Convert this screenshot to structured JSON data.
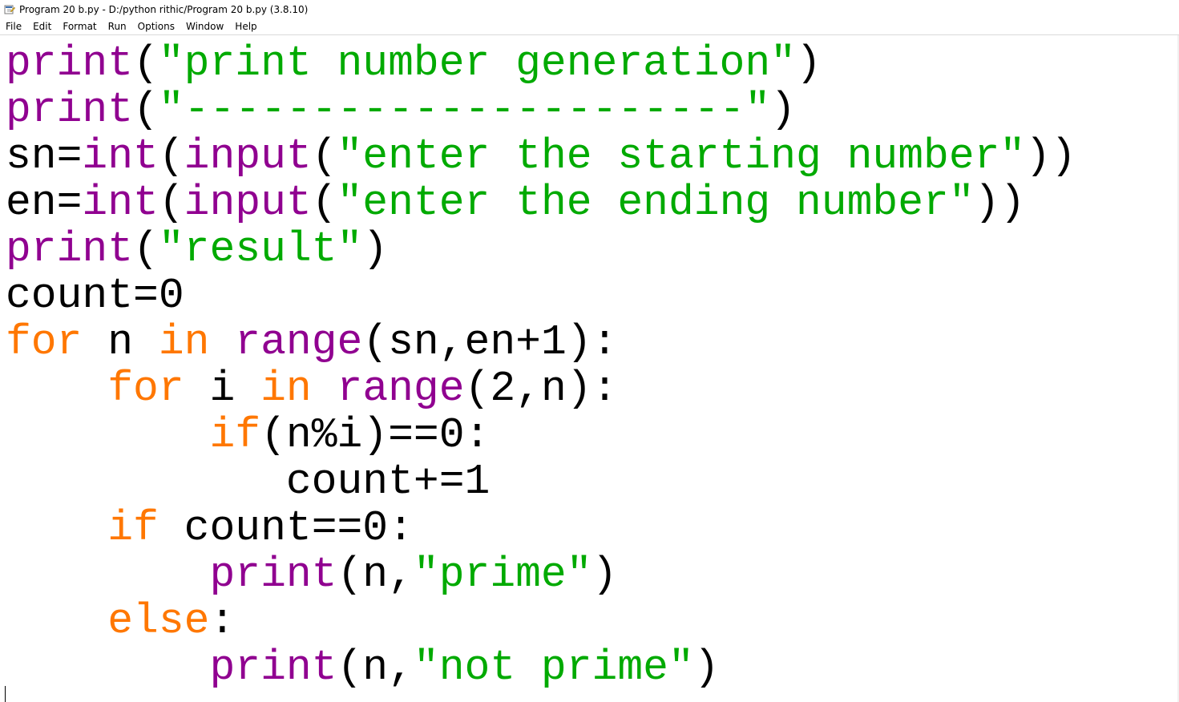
{
  "window": {
    "title": "Program 20 b.py - D:/python rithic/Program 20 b.py (3.8.10)"
  },
  "menu": {
    "items": [
      "File",
      "Edit",
      "Format",
      "Run",
      "Options",
      "Window",
      "Help"
    ]
  },
  "colors": {
    "builtin": "#900090",
    "string": "#00aa00",
    "keyword": "#ff7700",
    "default": "#000000"
  },
  "icons": {
    "app": "python-idle-icon"
  },
  "code": {
    "lines": [
      [
        {
          "t": "print",
          "c": "builtin"
        },
        {
          "t": "(",
          "c": "default"
        },
        {
          "t": "\"print number generation\"",
          "c": "string"
        },
        {
          "t": ")",
          "c": "default"
        }
      ],
      [
        {
          "t": "print",
          "c": "builtin"
        },
        {
          "t": "(",
          "c": "default"
        },
        {
          "t": "\"----------------------\"",
          "c": "string"
        },
        {
          "t": ")",
          "c": "default"
        }
      ],
      [
        {
          "t": "sn=",
          "c": "default"
        },
        {
          "t": "int",
          "c": "builtin"
        },
        {
          "t": "(",
          "c": "default"
        },
        {
          "t": "input",
          "c": "builtin"
        },
        {
          "t": "(",
          "c": "default"
        },
        {
          "t": "\"enter the starting number\"",
          "c": "string"
        },
        {
          "t": "))",
          "c": "default"
        }
      ],
      [
        {
          "t": "en=",
          "c": "default"
        },
        {
          "t": "int",
          "c": "builtin"
        },
        {
          "t": "(",
          "c": "default"
        },
        {
          "t": "input",
          "c": "builtin"
        },
        {
          "t": "(",
          "c": "default"
        },
        {
          "t": "\"enter the ending number\"",
          "c": "string"
        },
        {
          "t": "))",
          "c": "default"
        }
      ],
      [
        {
          "t": "print",
          "c": "builtin"
        },
        {
          "t": "(",
          "c": "default"
        },
        {
          "t": "\"result\"",
          "c": "string"
        },
        {
          "t": ")",
          "c": "default"
        }
      ],
      [
        {
          "t": "count=0",
          "c": "default"
        }
      ],
      [
        {
          "t": "for",
          "c": "keyword"
        },
        {
          "t": " n ",
          "c": "default"
        },
        {
          "t": "in",
          "c": "keyword"
        },
        {
          "t": " ",
          "c": "default"
        },
        {
          "t": "range",
          "c": "builtin"
        },
        {
          "t": "(sn,en+1):",
          "c": "default"
        }
      ],
      [
        {
          "t": "    ",
          "c": "default"
        },
        {
          "t": "for",
          "c": "keyword"
        },
        {
          "t": " i ",
          "c": "default"
        },
        {
          "t": "in",
          "c": "keyword"
        },
        {
          "t": " ",
          "c": "default"
        },
        {
          "t": "range",
          "c": "builtin"
        },
        {
          "t": "(2,n):",
          "c": "default"
        }
      ],
      [
        {
          "t": "        ",
          "c": "default"
        },
        {
          "t": "if",
          "c": "keyword"
        },
        {
          "t": "(n%i)==0:",
          "c": "default"
        }
      ],
      [
        {
          "t": "           count+=1",
          "c": "default"
        }
      ],
      [
        {
          "t": "    ",
          "c": "default"
        },
        {
          "t": "if",
          "c": "keyword"
        },
        {
          "t": " count==0:",
          "c": "default"
        }
      ],
      [
        {
          "t": "        ",
          "c": "default"
        },
        {
          "t": "print",
          "c": "builtin"
        },
        {
          "t": "(n,",
          "c": "default"
        },
        {
          "t": "\"prime\"",
          "c": "string"
        },
        {
          "t": ")",
          "c": "default"
        }
      ],
      [
        {
          "t": "    ",
          "c": "default"
        },
        {
          "t": "else",
          "c": "keyword"
        },
        {
          "t": ":",
          "c": "default"
        }
      ],
      [
        {
          "t": "        ",
          "c": "default"
        },
        {
          "t": "print",
          "c": "builtin"
        },
        {
          "t": "(n,",
          "c": "default"
        },
        {
          "t": "\"not prime\"",
          "c": "string"
        },
        {
          "t": ")",
          "c": "default"
        }
      ]
    ]
  }
}
